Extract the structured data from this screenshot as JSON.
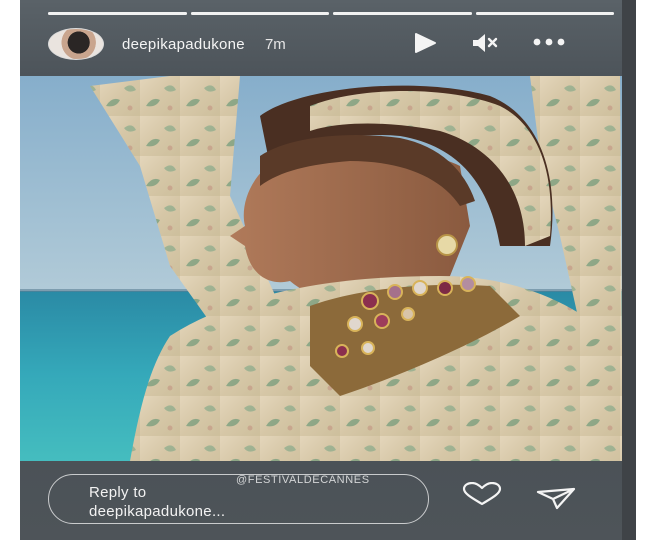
{
  "story": {
    "username": "deepikapadukone",
    "timestamp": "7m",
    "progress_segments": [
      1,
      1,
      1,
      1
    ],
    "watermark": "@FESTIVALDECANNES"
  },
  "controls": {
    "play_icon": "play-icon",
    "mute_icon": "muted-speaker-icon",
    "more_icon": "more-options-icon"
  },
  "reply": {
    "placeholder_line1": "Reply to",
    "placeholder_line2": "deepikapadukone..."
  },
  "footer": {
    "like_icon": "heart-icon",
    "share_icon": "send-icon"
  },
  "colors": {
    "background": "#4c5359",
    "text": "#f4f4f4"
  }
}
